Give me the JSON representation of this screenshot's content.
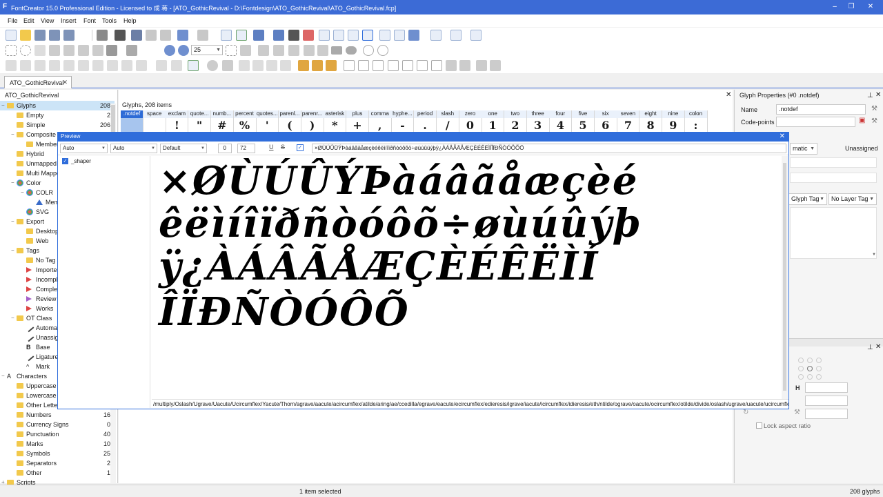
{
  "window": {
    "title": "FontCreator 15.0 Professional Edition - Licensed to 成 蒋 - [ATO_GothicRevival - D:\\Fontdesign\\ATO_GothicRevival\\ATO_GothicRevival.fcp]",
    "app_icon": "F"
  },
  "menu": [
    "File",
    "Edit",
    "View",
    "Insert",
    "Font",
    "Tools",
    "Help"
  ],
  "toolbar": {
    "zoom_value": "25"
  },
  "tabs": {
    "doc_tab": "ATO_GothicRevival"
  },
  "left_panel": {
    "title": "ATO_GothicRevival",
    "tree": [
      {
        "label": "Glyphs",
        "count": "208",
        "level": 0,
        "exp": "−",
        "selected": true,
        "icon": "folder"
      },
      {
        "label": "Empty",
        "count": "2",
        "level": 1,
        "icon": "folder"
      },
      {
        "label": "Simple",
        "count": "206",
        "level": 1,
        "icon": "folder"
      },
      {
        "label": "Composite",
        "count": "",
        "level": 1,
        "exp": "−",
        "icon": "folder"
      },
      {
        "label": "Members",
        "count": "",
        "level": 2,
        "icon": "folder"
      },
      {
        "label": "Hybrid",
        "count": "",
        "level": 1,
        "icon": "folder"
      },
      {
        "label": "Unmapped",
        "count": "",
        "level": 1,
        "icon": "folder"
      },
      {
        "label": "Multi Mapped",
        "count": "",
        "level": 1,
        "icon": "folder"
      },
      {
        "label": "Color",
        "count": "",
        "level": 1,
        "exp": "−",
        "icon": "color"
      },
      {
        "label": "COLR",
        "count": "",
        "level": 2,
        "exp": "−",
        "icon": "color"
      },
      {
        "label": "Members",
        "count": "",
        "level": 3,
        "icon": "triangle"
      },
      {
        "label": "SVG",
        "count": "",
        "level": 2,
        "icon": "color"
      },
      {
        "label": "Export",
        "count": "",
        "level": 1,
        "exp": "−",
        "icon": "folder"
      },
      {
        "label": "Desktop",
        "count": "",
        "level": 2,
        "icon": "folder"
      },
      {
        "label": "Web",
        "count": "",
        "level": 2,
        "icon": "folder"
      },
      {
        "label": "Tags",
        "count": "",
        "level": 1,
        "exp": "−",
        "icon": "folder"
      },
      {
        "label": "No Tag",
        "count": "",
        "level": 2,
        "icon": "folder"
      },
      {
        "label": "Imported",
        "count": "",
        "level": 2,
        "icon": "flag-red"
      },
      {
        "label": "Incomplete",
        "count": "",
        "level": 2,
        "icon": "flag-red"
      },
      {
        "label": "Completed",
        "count": "",
        "level": 2,
        "icon": "flag-red"
      },
      {
        "label": "Review",
        "count": "",
        "level": 2,
        "icon": "flag-purple"
      },
      {
        "label": "Works",
        "count": "",
        "level": 2,
        "icon": "flag-red"
      },
      {
        "label": "OT Class",
        "count": "",
        "level": 1,
        "exp": "−",
        "icon": "folder"
      },
      {
        "label": "Automatic",
        "count": "",
        "level": 2,
        "icon": "pen"
      },
      {
        "label": "Unassigned",
        "count": "",
        "level": 2,
        "icon": "pen"
      },
      {
        "label": "Base",
        "count": "",
        "level": 2,
        "icon": "B"
      },
      {
        "label": "Ligature",
        "count": "",
        "level": 2,
        "icon": "pen"
      },
      {
        "label": "Mark",
        "count": "",
        "level": 2,
        "icon": "caret"
      },
      {
        "label": "Characters",
        "count": "",
        "level": 0,
        "exp": "−",
        "icon": "A"
      },
      {
        "label": "Uppercase",
        "count": "",
        "level": 1,
        "icon": "folder"
      },
      {
        "label": "Lowercase",
        "count": "",
        "level": 1,
        "icon": "folder"
      },
      {
        "label": "Other Letters",
        "count": "",
        "level": 1,
        "icon": "folder"
      },
      {
        "label": "Numbers",
        "count": "16",
        "level": 1,
        "icon": "folder"
      },
      {
        "label": "Currency Signs",
        "count": "0",
        "level": 1,
        "icon": "folder"
      },
      {
        "label": "Punctuation",
        "count": "40",
        "level": 1,
        "icon": "folder"
      },
      {
        "label": "Marks",
        "count": "10",
        "level": 1,
        "icon": "folder"
      },
      {
        "label": "Symbols",
        "count": "25",
        "level": 1,
        "icon": "folder"
      },
      {
        "label": "Separators",
        "count": "2",
        "level": 1,
        "icon": "folder"
      },
      {
        "label": "Other",
        "count": "1",
        "level": 1,
        "icon": "folder"
      },
      {
        "label": "Scripts",
        "count": "",
        "level": 0,
        "exp": "+",
        "icon": "folder"
      }
    ]
  },
  "glyph_panel": {
    "header": "Glyphs, 208 items",
    "glyphs": [
      {
        "name": ".notdef",
        "char": "",
        "selected": true
      },
      {
        "name": "space",
        "char": ""
      },
      {
        "name": "exclam",
        "char": "!"
      },
      {
        "name": "quote...",
        "char": "\""
      },
      {
        "name": "numb...",
        "char": "#"
      },
      {
        "name": "percent",
        "char": "%"
      },
      {
        "name": "quotes...",
        "char": "'"
      },
      {
        "name": "parenl...",
        "char": "("
      },
      {
        "name": "parenr...",
        "char": ")"
      },
      {
        "name": "asterisk",
        "char": "*"
      },
      {
        "name": "plus",
        "char": "+"
      },
      {
        "name": "comma",
        "char": ","
      },
      {
        "name": "hyphe...",
        "char": "-"
      },
      {
        "name": "period",
        "char": "."
      },
      {
        "name": "slash",
        "char": "/"
      },
      {
        "name": "zero",
        "char": "0"
      },
      {
        "name": "one",
        "char": "1"
      },
      {
        "name": "two",
        "char": "2"
      },
      {
        "name": "three",
        "char": "3"
      },
      {
        "name": "four",
        "char": "4"
      },
      {
        "name": "five",
        "char": "5"
      },
      {
        "name": "six",
        "char": "6"
      },
      {
        "name": "seven",
        "char": "7"
      },
      {
        "name": "eight",
        "char": "8"
      },
      {
        "name": "nine",
        "char": "9"
      },
      {
        "name": "colon",
        "char": ":"
      }
    ]
  },
  "glyph_properties": {
    "title": "Glyph Properties (#0 .notdef)",
    "name_label": "Name",
    "name_value": ".notdef",
    "codepoints_label": "Code-points",
    "codepoints_value": "",
    "class_value": "Automatic",
    "class_display": "matic",
    "unassigned_label": "Unassigned",
    "glyph_tag": "Glyph Tag",
    "layer_tag": "No Layer Tag",
    "h_label": "H",
    "lock_label": "Lock aspect ratio"
  },
  "preview": {
    "title": "Preview",
    "script_combo": "Auto",
    "lang_combo": "Auto",
    "feature_combo": "Default",
    "spin1": "0",
    "spin2": "72",
    "text": "×ØÙÚÛÜÝÞàáâãäåæçèéêëìíîïðñòóôõö÷øùúûüýþÿ¿ÀÁÂÃÄÅÆÇÈÉÊËÌÍÎÏÐÑÒÓÔÕÖ",
    "shaper_label": "_shaper",
    "rows": [
      "×ØÙÚÛÝÞàáâãåæçèé",
      "êëìíîïðñòóôõ÷øùúûýþ",
      "ÿ¿ÀÁÂÃÅÆÇÈÉÊËÌÍ",
      "ÎÏÐÑÒÓÔÕ"
    ],
    "glyph_names": "/multiply/Oslash/Ugrave/Uacute/Ucircumflex/Yacute/Thorn/agrave/aacute/acircumflex/atilde/aring/ae/ccedilla/egrave/eacute/ecircumflex/edieresis/igrave/iacute/icircumflex/idieresis/eth/ntilde/ograve/oacute/ocircumflex/otilde/divide/oslash/ugrave/uacute/ucircumflex/yacute/thorn/ydieresis/questiondown/Agrave/Aacute"
  },
  "status": {
    "selection": "1 item selected",
    "glyph_count": "208 glyphs"
  },
  "colors": {
    "accent": "#2f6ddb",
    "title_bar": "#3c6bd6",
    "folder": "#f2c94c"
  }
}
